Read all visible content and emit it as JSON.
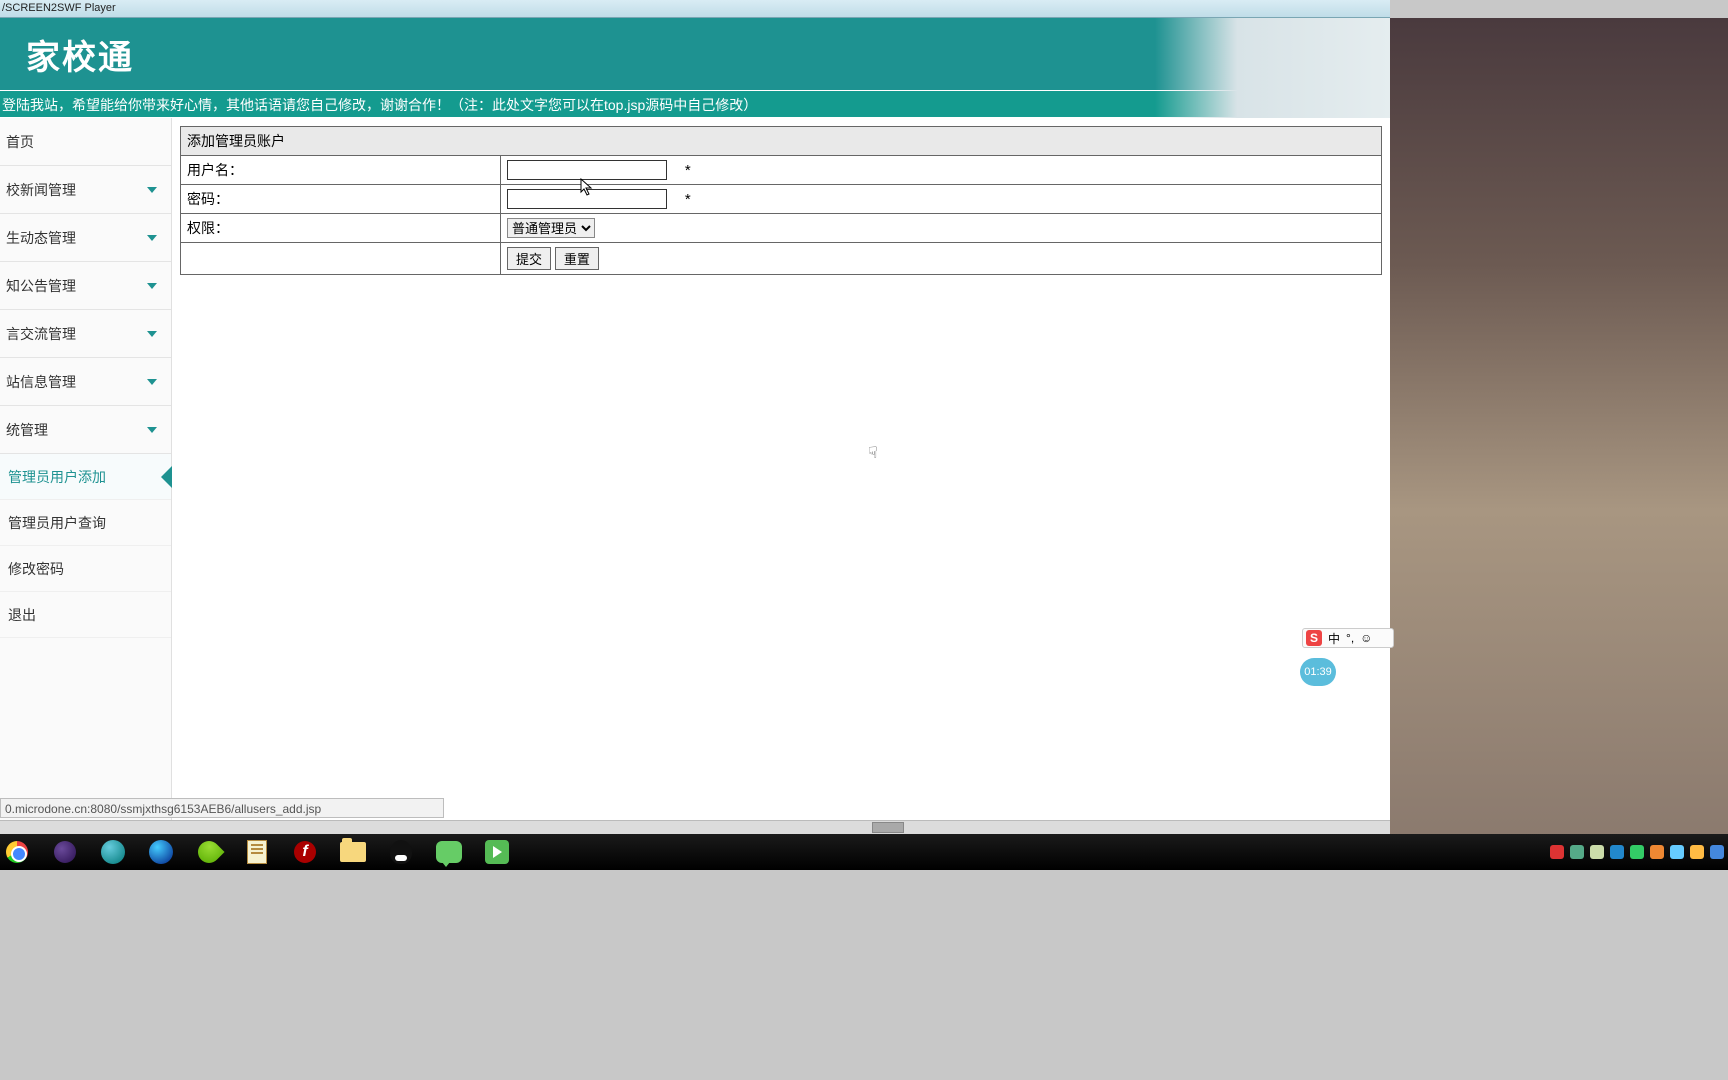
{
  "window": {
    "title": "/SCREEN2SWF Player"
  },
  "header": {
    "brand": "家校通"
  },
  "banner": {
    "text": "登陆我站，希望能给你带来好心情，其他话语请您自己修改，谢谢合作！（注：此处文字您可以在top.jsp源码中自己修改）"
  },
  "sidebar": {
    "items": [
      {
        "label": "首页",
        "has_caret": false
      },
      {
        "label": "校新闻管理",
        "has_caret": true
      },
      {
        "label": "生动态管理",
        "has_caret": true
      },
      {
        "label": "知公告管理",
        "has_caret": true
      },
      {
        "label": "言交流管理",
        "has_caret": true
      },
      {
        "label": "站信息管理",
        "has_caret": true
      },
      {
        "label": "统管理",
        "has_caret": true
      }
    ],
    "subitems": [
      {
        "label": "管理员用户添加",
        "active": true
      },
      {
        "label": "管理员用户查询",
        "active": false
      },
      {
        "label": "修改密码",
        "active": false
      },
      {
        "label": "退出",
        "active": false
      }
    ]
  },
  "form": {
    "title": "添加管理员账户",
    "username_label": "用户名：",
    "username_value": "",
    "password_label": "密码：",
    "password_value": "",
    "role_label": "权限：",
    "role_selected": "普通管理员",
    "required_mark": "*",
    "submit_label": "提交",
    "reset_label": "重置"
  },
  "status": {
    "url": "0.microdone.cn:8080/ssmjxthsg6153AEB6/allusers_add.jsp"
  },
  "ime": {
    "brand": "S",
    "lang": "中",
    "punct": "°,",
    "emoji": "☺"
  },
  "timer": {
    "value": "01:39"
  }
}
